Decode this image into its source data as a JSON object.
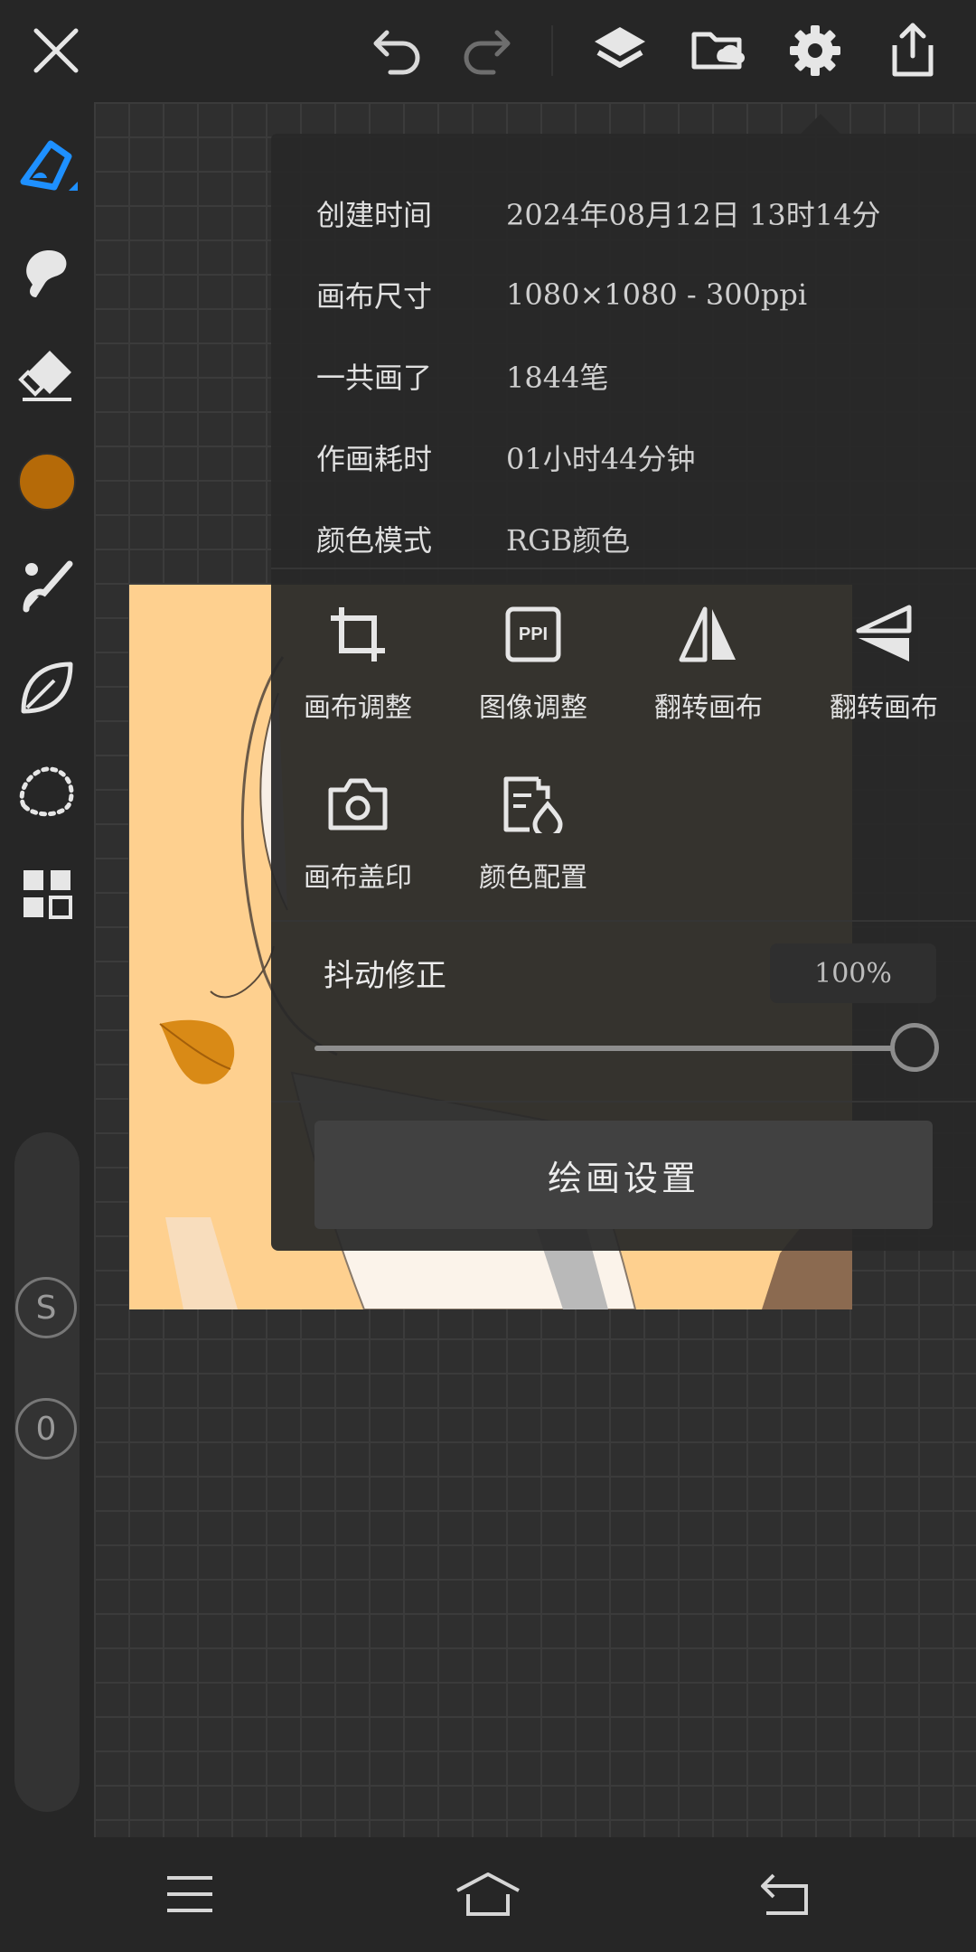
{
  "info": [
    {
      "key": "创建时间",
      "value": "2024年08月12日 13时14分"
    },
    {
      "key": "画布尺寸",
      "value": "1080×1080 - 300ppi"
    },
    {
      "key": "一共画了",
      "value": "1844笔"
    },
    {
      "key": "作画耗时",
      "value": "01小时44分钟"
    },
    {
      "key": "颜色模式",
      "value": "RGB颜色"
    }
  ],
  "actions": [
    {
      "label": "画布调整",
      "icon": "crop-icon"
    },
    {
      "label": "图像调整",
      "icon": "ppi-icon",
      "icon_text": "PPI"
    },
    {
      "label": "翻转画布",
      "icon": "flip-horizontal-icon"
    },
    {
      "label": "翻转画布",
      "icon": "flip-vertical-icon"
    },
    {
      "label": "画布盖印",
      "icon": "camera-icon"
    },
    {
      "label": "颜色配置",
      "icon": "color-profile-icon"
    }
  ],
  "stabilizer": {
    "label": "抖动修正",
    "value": "100%",
    "level": 1.0
  },
  "draw_settings_label": "绘画设置",
  "left_tools": {
    "current_color": "#b56a08",
    "badge_s": "S",
    "badge_0": "0"
  },
  "colors": {
    "accent": "#1e90ff",
    "artwork_bg": "#fed08f",
    "leaf": "#d98a16"
  }
}
